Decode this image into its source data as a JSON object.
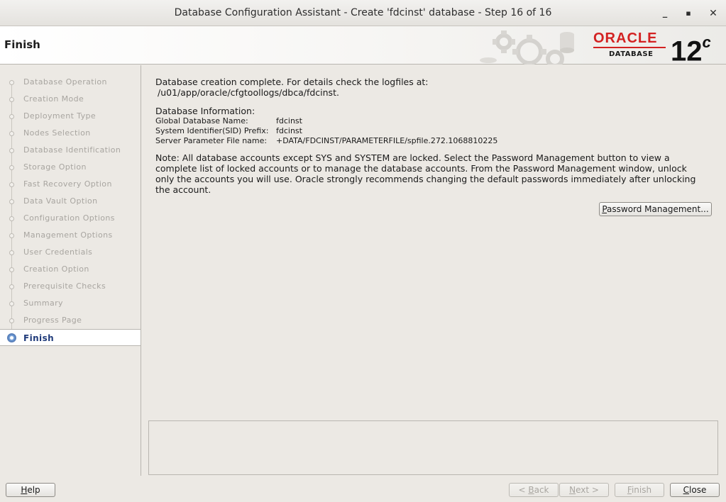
{
  "window": {
    "title": "Database Configuration Assistant - Create 'fdcinst' database - Step 16 of 16",
    "minimize_glyph": "_",
    "maximize_glyph": "▪",
    "close_glyph": "✕"
  },
  "header": {
    "page_title": "Finish",
    "logo_word": "ORACLE",
    "logo_sub": "DATABASE",
    "version_main": "12",
    "version_sup": "c"
  },
  "nav": {
    "items": [
      {
        "label": "Database Operation",
        "state": "done"
      },
      {
        "label": "Creation Mode",
        "state": "done"
      },
      {
        "label": "Deployment Type",
        "state": "done"
      },
      {
        "label": "Nodes Selection",
        "state": "done"
      },
      {
        "label": "Database Identification",
        "state": "done"
      },
      {
        "label": "Storage Option",
        "state": "done"
      },
      {
        "label": "Fast Recovery Option",
        "state": "done"
      },
      {
        "label": "Data Vault Option",
        "state": "done"
      },
      {
        "label": "Configuration Options",
        "state": "done"
      },
      {
        "label": "Management Options",
        "state": "done"
      },
      {
        "label": "User Credentials",
        "state": "done"
      },
      {
        "label": "Creation Option",
        "state": "done"
      },
      {
        "label": "Prerequisite Checks",
        "state": "done"
      },
      {
        "label": "Summary",
        "state": "done"
      },
      {
        "label": "Progress Page",
        "state": "done"
      },
      {
        "label": "Finish",
        "state": "active"
      }
    ]
  },
  "content": {
    "completion_text": "Database creation complete. For details check the logfiles at:",
    "log_path": "/u01/app/oracle/cfgtoollogs/dbca/fdcinst.",
    "info_heading": "Database Information:",
    "info": [
      {
        "key": "Global Database Name:",
        "value": "fdcinst"
      },
      {
        "key": "System Identifier(SID) Prefix:",
        "value": "fdcinst"
      },
      {
        "key": "Server Parameter File name:",
        "value": "+DATA/FDCINST/PARAMETERFILE/spfile.272.1068810225"
      }
    ],
    "note": "Note: All database accounts except SYS and SYSTEM are locked. Select the Password Management button to view a complete list of locked accounts or to manage the database accounts. From the Password Management window, unlock only the accounts you will use. Oracle strongly recommends changing the default passwords immediately after unlocking the account.",
    "password_button_mnemonic": "P",
    "password_button_rest": "assword Management..."
  },
  "footer": {
    "help": {
      "mnemonic": "H",
      "rest": "elp"
    },
    "back": {
      "prefix": "< ",
      "mnemonic": "B",
      "rest": "ack"
    },
    "next": {
      "mnemonic": "N",
      "rest": "ext >"
    },
    "finish": {
      "mnemonic": "F",
      "rest": "inish"
    },
    "close": {
      "mnemonic": "C",
      "rest": "lose"
    }
  },
  "colors": {
    "oracle_red": "#d32222",
    "active_nav_text": "#1f3a7a"
  }
}
